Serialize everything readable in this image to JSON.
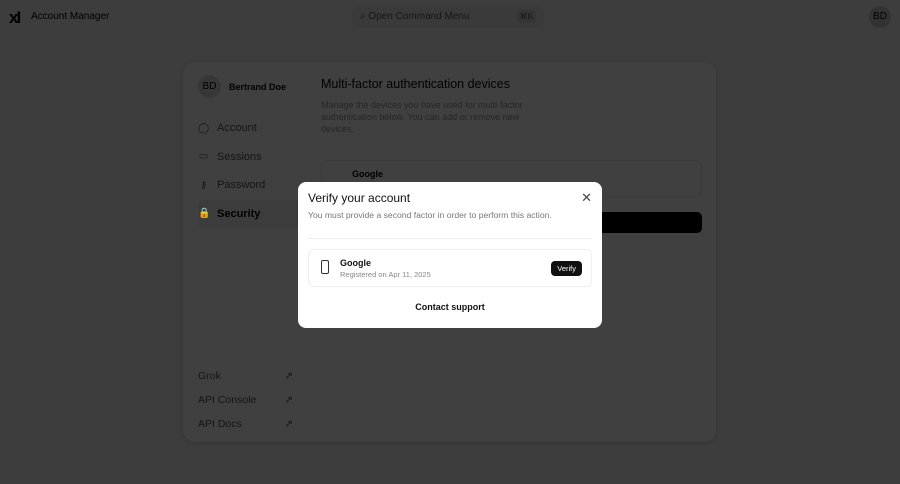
{
  "header": {
    "logo": "xI",
    "app_name": "Account Manager",
    "command_placeholder": "Open Command Menu",
    "shortcut": "⌘K",
    "avatar": "BD"
  },
  "user": {
    "initials": "BD",
    "name": "Bertrand Doe"
  },
  "nav": [
    {
      "label": "Account",
      "icon": "◯"
    },
    {
      "label": "Sessions",
      "icon": "▭"
    },
    {
      "label": "Password",
      "icon": "⚷"
    },
    {
      "label": "Security",
      "icon": "🔒"
    }
  ],
  "links": [
    {
      "label": "Grok"
    },
    {
      "label": "API Console"
    },
    {
      "label": "API Docs"
    }
  ],
  "main": {
    "title": "Multi-factor authentication devices",
    "description": "Manage the devices you have used for multi-factor authentication below. You can add or remove new devices.",
    "device_name": "Google"
  },
  "modal": {
    "title": "Verify your account",
    "subtitle": "You must provide a second factor in order to perform this action.",
    "device": {
      "name": "Google",
      "registered": "Registered on Apr 11, 2025",
      "verify_label": "Verify"
    },
    "contact_label": "Contact support"
  }
}
